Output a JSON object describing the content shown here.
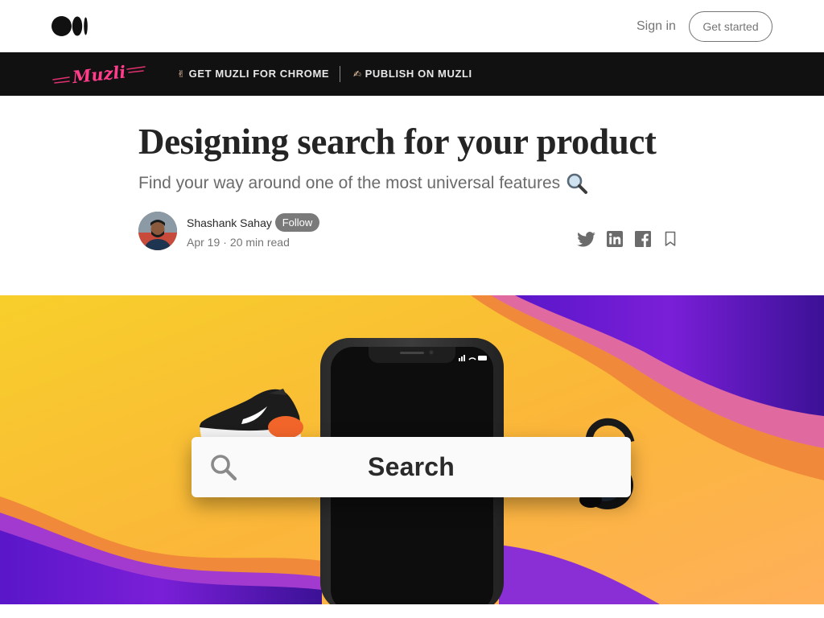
{
  "header": {
    "signin_label": "Sign in",
    "get_started_label": "Get started"
  },
  "publication_bar": {
    "logo_text": "Muzli",
    "link1_label": "GET MUZLI FOR CHROME",
    "link2_label": "PUBLISH ON MUZLI"
  },
  "article": {
    "title": "Designing search for your product",
    "subtitle": "Find your way around one of the most universal features",
    "author_name": "Shashank Sahay",
    "follow_label": "Follow",
    "date": "Apr 19",
    "separator": "·",
    "read_time": "20 min read"
  },
  "hero": {
    "search_text": "Search"
  },
  "icons": {
    "logo": "medium-logo-icon",
    "twitter": "twitter-icon",
    "linkedin": "linkedin-icon",
    "facebook": "facebook-icon",
    "bookmark": "bookmark-icon",
    "search": "search-icon"
  },
  "colors": {
    "bar_background": "#111111",
    "follow_background": "#7a7a7a",
    "muzli_pink": "#ff3d8b"
  }
}
